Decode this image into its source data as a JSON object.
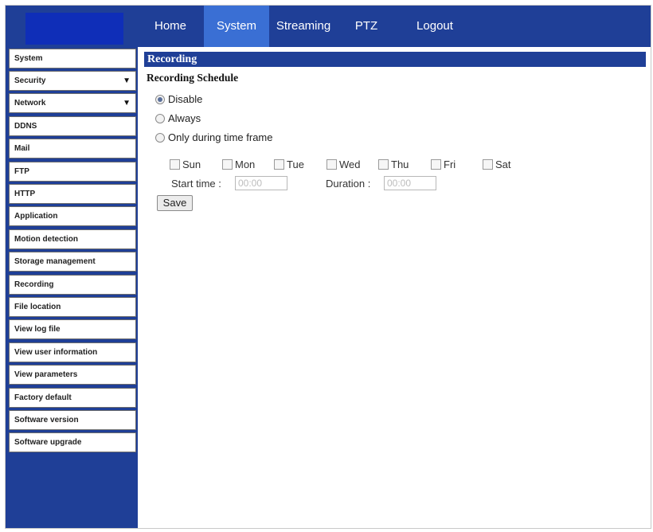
{
  "nav": {
    "items": [
      {
        "label": "Home"
      },
      {
        "label": "System"
      },
      {
        "label": "Streaming"
      },
      {
        "label": "PTZ"
      },
      {
        "label": "Logout"
      }
    ],
    "active": "System"
  },
  "sidebar": {
    "items": [
      {
        "label": "System"
      },
      {
        "label": "Security",
        "expandable": true
      },
      {
        "label": "Network",
        "expandable": true
      },
      {
        "label": "DDNS"
      },
      {
        "label": "Mail"
      },
      {
        "label": "FTP"
      },
      {
        "label": "HTTP"
      },
      {
        "label": "Application"
      },
      {
        "label": "Motion detection"
      },
      {
        "label": "Storage management"
      },
      {
        "label": "Recording"
      },
      {
        "label": "File location"
      },
      {
        "label": "View log file"
      },
      {
        "label": "View user information"
      },
      {
        "label": "View parameters"
      },
      {
        "label": "Factory default"
      },
      {
        "label": "Software version"
      },
      {
        "label": "Software upgrade"
      }
    ]
  },
  "recording": {
    "section_title": "Recording",
    "schedule_title": "Recording Schedule",
    "options": [
      {
        "label": "Disable",
        "checked": true
      },
      {
        "label": "Always",
        "checked": false
      },
      {
        "label": "Only during time frame",
        "checked": false
      }
    ],
    "days": [
      "Sun",
      "Mon",
      "Tue",
      "Wed",
      "Thu",
      "Fri",
      "Sat"
    ],
    "start_time_label": "Start time :",
    "start_time_value": "00:00",
    "duration_label": "Duration :",
    "duration_value": "00:00",
    "save_label": "Save"
  },
  "colors": {
    "header_blue": "#1f3f97",
    "active_tab": "#3a6fd4",
    "logo_blue": "#0f2eb8"
  }
}
